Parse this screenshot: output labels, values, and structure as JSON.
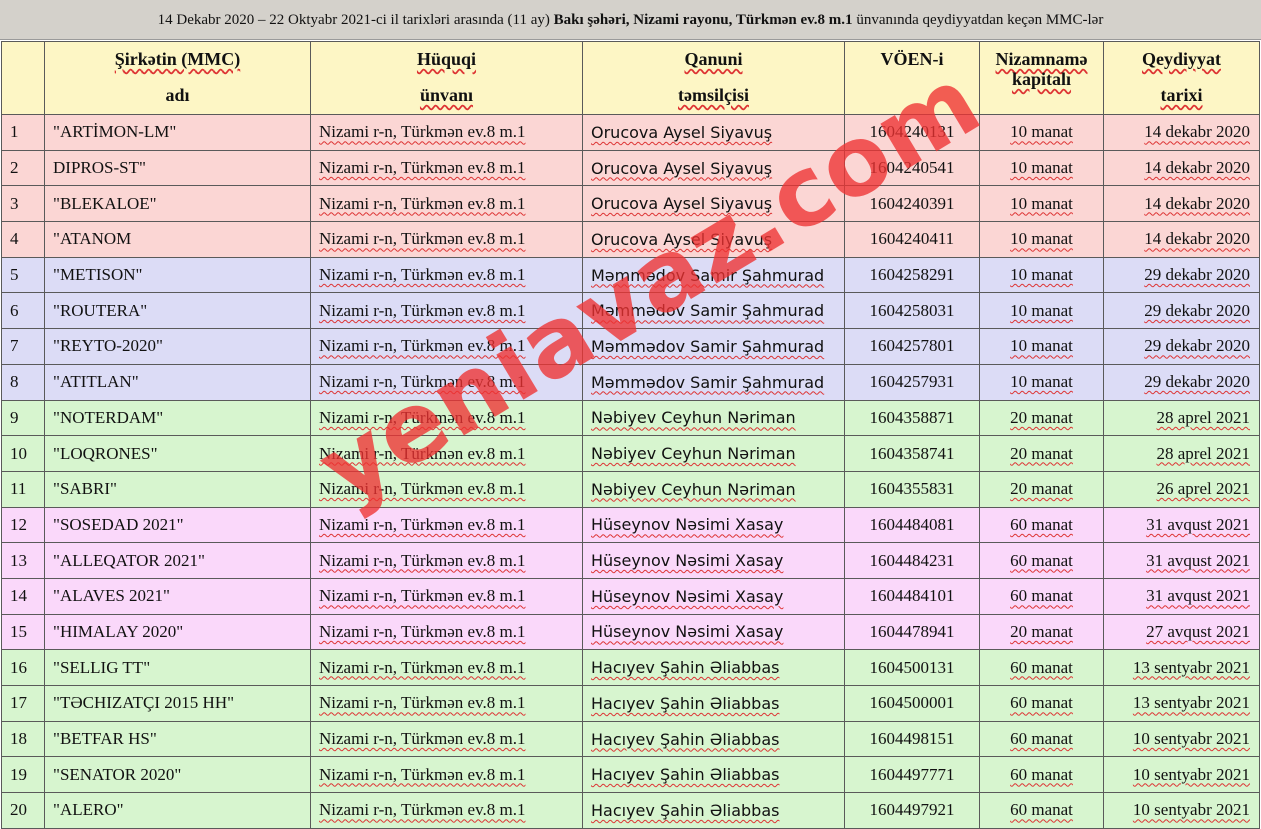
{
  "caption": {
    "part1": "14 Dekabr 2020 – 22 Oktyabr 2021-ci il tarixləri arasında (11 ay) ",
    "bold": "Bakı şəhəri, Nizami rayonu, Türkmən ev.8 m.1",
    "part2": " ünvanında qeydiyyatdan keçən MMC-lər"
  },
  "headers": {
    "name_l1": "Şirkətin (MMC)",
    "name_l2": "adı",
    "addr_l1": "Hüquqi",
    "addr_l2": "ünvanı",
    "rep_l1": "Qanuni",
    "rep_l2": "təmsilçisi",
    "voen": "VÖEN-i",
    "cap_l1": "Nizamnamə",
    "cap_l2": "kapitalı",
    "date_l1": "Qeydiyyat",
    "date_l2": "tarixi"
  },
  "colors": {
    "header": "#fdf6c5",
    "red": "#fbd6d4",
    "blue": "#dcdcf6",
    "green": "#d7f5cf",
    "pink": "#fad8fa"
  },
  "rows": [
    {
      "no": "1",
      "name": "\"ARTİMON-LM\"",
      "address": "Nizami r-n, Türkmən ev.8 m.1",
      "rep": "Orucova Aysel Siyavuş",
      "voen": "1604240131",
      "capital": "10 manat",
      "date": "14 dekabr 2020",
      "color": "red"
    },
    {
      "no": "2",
      "name": "DIPROS-ST\"",
      "address": "Nizami r-n, Türkmən ev.8 m.1",
      "rep": "Orucova Aysel Siyavuş",
      "voen": "1604240541",
      "capital": "10 manat",
      "date": "14 dekabr 2020",
      "color": "red"
    },
    {
      "no": "3",
      "name": "\"BLEKALOE\"",
      "address": "Nizami r-n, Türkmən ev.8 m.1",
      "rep": "Orucova Aysel Siyavuş",
      "voen": "1604240391",
      "capital": "10 manat",
      "date": "14 dekabr 2020",
      "color": "red"
    },
    {
      "no": "4",
      "name": "\"ATANOM",
      "address": "Nizami r-n, Türkmən ev.8 m.1",
      "rep": "Orucova Aysel Siyavuş",
      "voen": "1604240411",
      "capital": "10 manat",
      "date": "14 dekabr 2020",
      "color": "red"
    },
    {
      "no": "5",
      "name": "\"METISON\"",
      "address": "Nizami r-n, Türkmən ev.8 m.1",
      "rep": "Məmmədov Samir Şahmurad",
      "voen": "1604258291",
      "capital": "10 manat",
      "date": "29 dekabr 2020",
      "color": "blue"
    },
    {
      "no": "6",
      "name": "\"ROUTERA\"",
      "address": "Nizami r-n, Türkmən ev.8 m.1",
      "rep": "Məmmədov Samir Şahmurad",
      "voen": "1604258031",
      "capital": "10 manat",
      "date": "29 dekabr 2020",
      "color": "blue"
    },
    {
      "no": "7",
      "name": "\"REYTO-2020\"",
      "address": "Nizami r-n, Türkmən ev.8 m.1",
      "rep": "Məmmədov Samir Şahmurad",
      "voen": "1604257801",
      "capital": "10 manat",
      "date": "29 dekabr 2020",
      "color": "blue"
    },
    {
      "no": "8",
      "name": "\"ATITLAN\"",
      "address": "Nizami r-n, Türkmən ev.8 m.1",
      "rep": "Məmmədov Samir Şahmurad",
      "voen": "1604257931",
      "capital": "10 manat",
      "date": "29 dekabr 2020",
      "color": "blue"
    },
    {
      "no": "9",
      "name": "\"NOTERDAM\"",
      "address": "Nizami r-n, Türkmən ev.8 m.1",
      "rep": "Nəbiyev Ceyhun Nəriman",
      "voen": "1604358871",
      "capital": "20 manat",
      "date": "28 aprel 2021",
      "color": "green"
    },
    {
      "no": "10",
      "name": "\"LOQRONES\"",
      "address": "Nizami r-n, Türkmən ev.8 m.1",
      "rep": "Nəbiyev Ceyhun Nəriman",
      "voen": "1604358741",
      "capital": "20 manat",
      "date": "28 aprel 2021",
      "color": "green"
    },
    {
      "no": "11",
      "name": "\"SABRI\"",
      "address": "Nizami r-n, Türkmən ev.8 m.1",
      "rep": "Nəbiyev Ceyhun Nəriman",
      "voen": "1604355831",
      "capital": "20 manat",
      "date": "26 aprel 2021",
      "color": "green"
    },
    {
      "no": "12",
      "name": "\"SOSEDAD 2021\"",
      "address": "Nizami r-n, Türkmən ev.8 m.1",
      "rep": "Hüseynov Nəsimi Xasay",
      "voen": "1604484081",
      "capital": "60 manat",
      "date": "31 avqust 2021",
      "color": "pink"
    },
    {
      "no": "13",
      "name": "\"ALLEQATOR 2021\"",
      "address": "Nizami r-n, Türkmən ev.8 m.1",
      "rep": "Hüseynov Nəsimi Xasay",
      "voen": "1604484231",
      "capital": "60 manat",
      "date": "31 avqust 2021",
      "color": "pink"
    },
    {
      "no": "14",
      "name": "\"ALAVES 2021\"",
      "address": "Nizami r-n, Türkmən ev.8 m.1",
      "rep": "Hüseynov Nəsimi Xasay",
      "voen": "1604484101",
      "capital": "60 manat",
      "date": "31 avqust 2021",
      "color": "pink"
    },
    {
      "no": "15",
      "name": "\"HIMALAY 2020\"",
      "address": "Nizami r-n, Türkmən ev.8 m.1",
      "rep": "Hüseynov Nəsimi Xasay",
      "voen": "1604478941",
      "capital": "20 manat",
      "date": "27 avqust 2021",
      "color": "pink"
    },
    {
      "no": "16",
      "name": "\"SELLIG TT\"",
      "address": "Nizami r-n, Türkmən ev.8 m.1",
      "rep": "Hacıyev Şahin Əliabbas",
      "voen": "1604500131",
      "capital": "60 manat",
      "date": "13 sentyabr 2021",
      "color": "green"
    },
    {
      "no": "17",
      "name": "\"TƏCHIZATÇI 2015 HH\"",
      "address": "Nizami r-n, Türkmən ev.8 m.1",
      "rep": "Hacıyev Şahin Əliabbas",
      "voen": "1604500001",
      "capital": "60 manat",
      "date": "13 sentyabr 2021",
      "color": "green"
    },
    {
      "no": "18",
      "name": "\"BETFAR HS\"",
      "address": "Nizami r-n, Türkmən ev.8 m.1",
      "rep": "Hacıyev Şahin Əliabbas",
      "voen": "1604498151",
      "capital": "60 manat",
      "date": "10 sentyabr 2021",
      "color": "green"
    },
    {
      "no": "19",
      "name": "\"SENATOR 2020\"",
      "address": "Nizami r-n, Türkmən ev.8 m.1",
      "rep": "Hacıyev Şahin Əliabbas",
      "voen": "1604497771",
      "capital": "60 manat",
      "date": "10 sentyabr 2021",
      "color": "green"
    },
    {
      "no": "20",
      "name": "\"ALERO\"",
      "address": "Nizami r-n, Türkmən ev.8 m.1",
      "rep": "Hacıyev Şahin Əliabbas",
      "voen": "1604497921",
      "capital": "60 manat",
      "date": "10 sentyabr 2021",
      "color": "green"
    }
  ],
  "watermark": "yeniavaz.com"
}
